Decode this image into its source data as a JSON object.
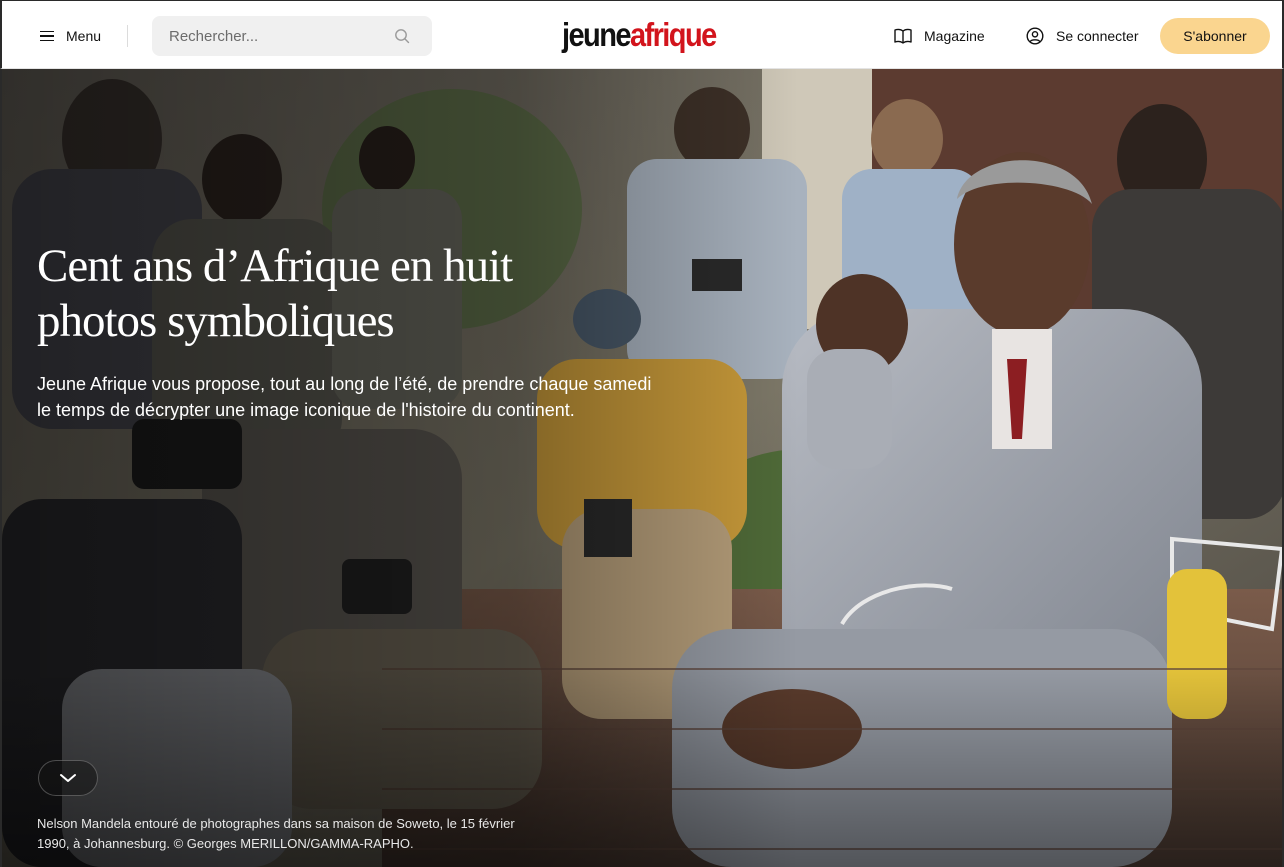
{
  "header": {
    "menu_label": "Menu",
    "search_placeholder": "Rechercher...",
    "logo_part1": "jeune",
    "logo_part2": "afrique",
    "magazine_label": "Magazine",
    "login_label": "Se connecter",
    "subscribe_label": "S'abonner"
  },
  "hero": {
    "title": "Cent ans d’Afrique en huit photos symboliques",
    "lede": "Jeune Afrique vous propose, tout au long de l’été, de prendre chaque samedi le temps de décrypter une image iconique de l'histoire du continent.",
    "caption": "Nelson Mandela entouré de photographes dans sa maison de Soweto, le 15 février 1990, à Johannesburg. © Georges MERILLON/GAMMA-RAPHO."
  },
  "colors": {
    "brand_red": "#d2141c",
    "subscribe_bg": "#fad58f"
  },
  "icons": [
    "menu-icon",
    "search-icon",
    "book-icon",
    "user-icon",
    "chevron-down-icon"
  ]
}
